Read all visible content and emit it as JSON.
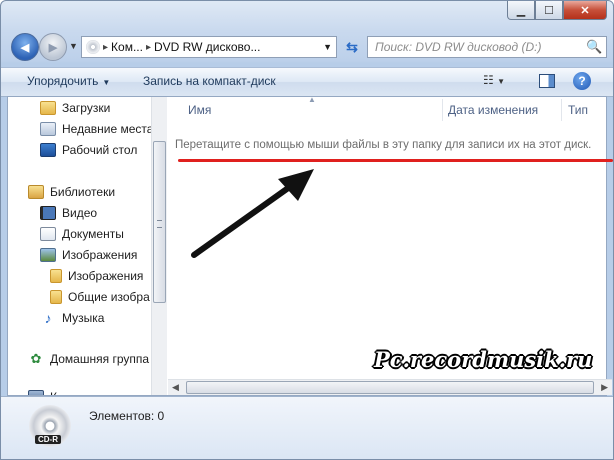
{
  "window": {
    "controls": {
      "minimize": "▁",
      "maximize": "☐",
      "close": "✕"
    }
  },
  "nav": {
    "back_icon": "◀",
    "forward_icon": "▶",
    "address_segments": [
      "Ком...",
      "DVD RW дисково..."
    ],
    "search_placeholder": "Поиск: DVD RW дисковод (D:)"
  },
  "toolbar": {
    "organize_label": "Упорядочить",
    "burn_label": "Запись на компакт-диск",
    "help_label": "?"
  },
  "sidebar": {
    "items": [
      {
        "label": "Загрузки",
        "icon": "downloads-folder-icon"
      },
      {
        "label": "Недавние места",
        "icon": "recent-places-icon"
      },
      {
        "label": "Рабочий стол",
        "icon": "desktop-icon"
      },
      {
        "label": "Библиотеки",
        "icon": "libraries-icon"
      },
      {
        "label": "Видео",
        "icon": "video-icon"
      },
      {
        "label": "Документы",
        "icon": "documents-icon"
      },
      {
        "label": "Изображения",
        "icon": "images-icon"
      },
      {
        "label": "Изображения",
        "icon": "folder-icon"
      },
      {
        "label": "Общие изобра",
        "icon": "folder-icon"
      },
      {
        "label": "Музыка",
        "icon": "music-icon"
      },
      {
        "label": "Домашняя группа",
        "icon": "homegroup-icon"
      },
      {
        "label": "К",
        "icon": "computer-icon"
      }
    ]
  },
  "columns": {
    "name": "Имя",
    "date": "Дата изменения",
    "type": "Тип"
  },
  "main": {
    "empty_message": "Перетащите с помощью мыши файлы в эту папку для записи их на этот диск."
  },
  "annotation": {
    "line_color": "#e0201e",
    "arrow_color": "#111111"
  },
  "watermark": "Pc.recordmusik.ru",
  "details": {
    "count_label": "Элементов: 0",
    "disc_label": "CD-R"
  }
}
